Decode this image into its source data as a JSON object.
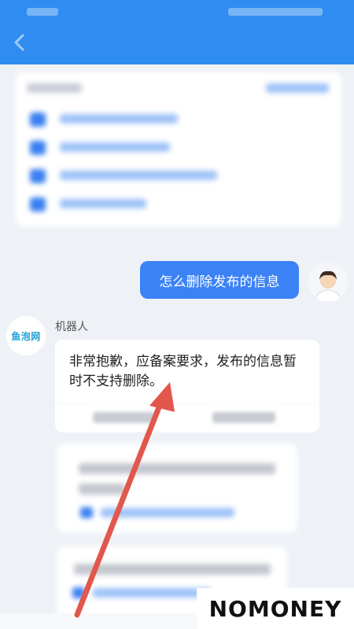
{
  "colors": {
    "header_bg": "#2f8cf0",
    "user_bubble": "#3b82f6",
    "arrow": "#e2574c",
    "link": "#3a7ff0"
  },
  "header": {
    "title": "",
    "back_icon": "back-arrow-icon"
  },
  "faq": {
    "heading": "",
    "more": "",
    "items": [
      {
        "label": ""
      },
      {
        "label": ""
      },
      {
        "label": ""
      },
      {
        "label": ""
      }
    ]
  },
  "chat": {
    "user_message": "怎么删除发布的信息",
    "bot_avatar_text": "鱼泡网",
    "bot_name": "机器人",
    "bot_reply": "非常抱歉，应备案要求，发布的信息暂时不支持删除。",
    "actions": [
      {
        "label": ""
      },
      {
        "label": ""
      }
    ]
  },
  "watermark": {
    "text": "NOMONEY"
  }
}
